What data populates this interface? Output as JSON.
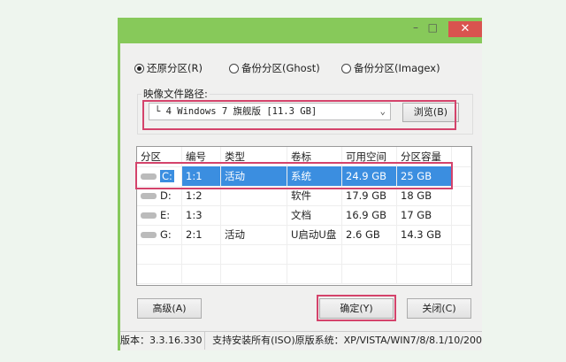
{
  "window": {
    "close": "✕",
    "minimize": "–",
    "maximize": "□"
  },
  "modes": [
    {
      "label": "还原分区(R)",
      "selected": true
    },
    {
      "label": "备份分区(Ghost)",
      "selected": false
    },
    {
      "label": "备份分区(Imagex)",
      "selected": false
    }
  ],
  "image_path": {
    "label": "映像文件路径:",
    "value": "└ 4 Windows 7 旗舰版 [11.3 GB]",
    "browse": "浏览(B)"
  },
  "table": {
    "headers": [
      "分区",
      "编号",
      "类型",
      "卷标",
      "可用空间",
      "分区容量"
    ],
    "rows": [
      [
        "C:",
        "1:1",
        "活动",
        "系统",
        "24.9 GB",
        "25 GB"
      ],
      [
        "D:",
        "1:2",
        "",
        "软件",
        "17.9 GB",
        "18 GB"
      ],
      [
        "E:",
        "1:3",
        "",
        "文档",
        "16.9 GB",
        "17 GB"
      ],
      [
        "G:",
        "2:1",
        "活动",
        "U启动U盘",
        "2.6 GB",
        "14.3 GB"
      ]
    ]
  },
  "buttons": {
    "advanced": "高级(A)",
    "ok": "确定(Y)",
    "close": "关闭(C)"
  },
  "status": {
    "version": "版本：3.3.16.330",
    "support": "支持安装所有(ISO)原版系统：XP/VISTA/WIN7/8/8.1/10/200"
  }
}
